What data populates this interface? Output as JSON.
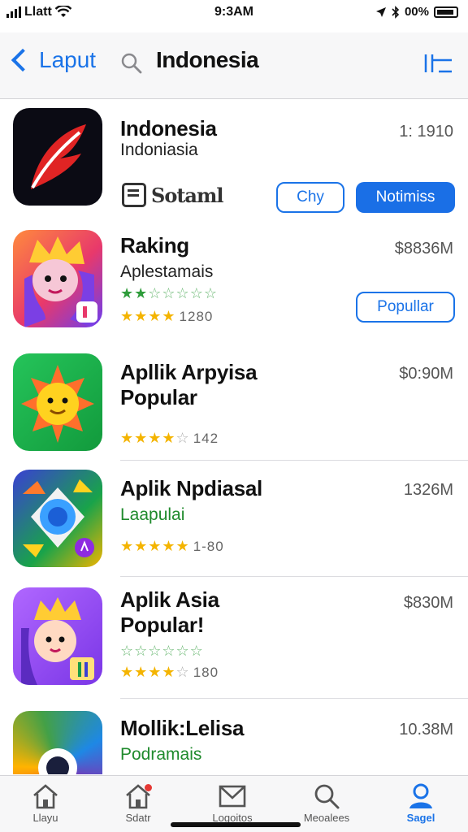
{
  "status": {
    "carrier": "Llatt",
    "time": "9:3AM",
    "battery": "00%"
  },
  "nav": {
    "back_label": "Laput",
    "title": "Indonesia"
  },
  "apps": [
    {
      "name": "Indonesia",
      "subtitle": "Indoniasia",
      "price": "1: 1910",
      "badge": "Sotaml",
      "btn1": "Chy",
      "btn2": "Notimiss"
    },
    {
      "name": "Raking",
      "subtitle": "Aplestamais",
      "price": "$8836M",
      "rating_count": "1280",
      "button": "Popullar"
    },
    {
      "name_line1": "Apllik Arpyisa",
      "name_line2": "Popular",
      "price": "$0:90M",
      "rating_count": "142"
    },
    {
      "name": "Aplik Npdiasal",
      "subtitle": "Laapulai",
      "price": "1326M",
      "rating_count": "1-80"
    },
    {
      "name_line1": "Aplik Asia",
      "name_line2": "Popular!",
      "price": "$830M",
      "rating_count": "180"
    },
    {
      "name": "Mollik:Lelisa",
      "subtitle": "Podramais",
      "price": "10.38M"
    }
  ],
  "tabs": [
    {
      "label": "Llayu",
      "icon": "home-icon"
    },
    {
      "label": "Sdatr",
      "icon": "home-badge-icon"
    },
    {
      "label": "Logoitos",
      "icon": "envelope-icon"
    },
    {
      "label": "Meoalees",
      "icon": "search-icon"
    },
    {
      "label": "Sagel",
      "icon": "person-icon"
    }
  ],
  "colors": {
    "accent": "#1a73e8",
    "star": "#f4b400",
    "green": "#1f8a2c"
  }
}
